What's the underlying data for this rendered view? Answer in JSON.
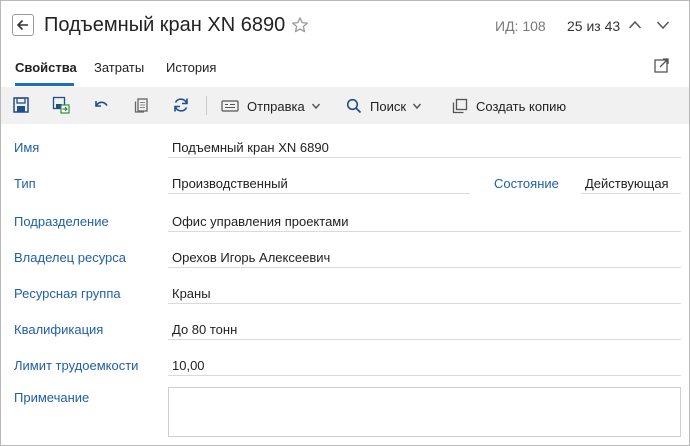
{
  "header": {
    "title": "Подъемный кран XN 6890",
    "id_text": "ИД: 108",
    "position_text": "25 из 43"
  },
  "tabs": [
    {
      "label": "Свойства",
      "active": true
    },
    {
      "label": "Затраты",
      "active": false
    },
    {
      "label": "История",
      "active": false
    }
  ],
  "toolbar": {
    "send_label": "Отправка",
    "search_label": "Поиск",
    "copy_label": "Создать копию"
  },
  "form": {
    "name": {
      "label": "Имя",
      "value": "Подъемный кран XN 6890"
    },
    "type": {
      "label": "Тип",
      "value": "Производственный"
    },
    "state": {
      "label": "Состояние",
      "value": "Действующая"
    },
    "department": {
      "label": "Подразделение",
      "value": "Офис управления проектами"
    },
    "owner": {
      "label": "Владелец ресурса",
      "value": "Орехов Игорь Алексеевич"
    },
    "group": {
      "label": "Ресурсная группа",
      "value": "Краны"
    },
    "qualification": {
      "label": "Квалификация",
      "value": "До 80 тонн"
    },
    "limit": {
      "label": "Лимит трудоемкости",
      "value": "10,00"
    },
    "note": {
      "label": "Примечание",
      "value": ""
    }
  },
  "colors": {
    "accent": "#1f6fb5",
    "label": "#1f5fa8",
    "toolbar_bg": "#f1f1f1"
  }
}
